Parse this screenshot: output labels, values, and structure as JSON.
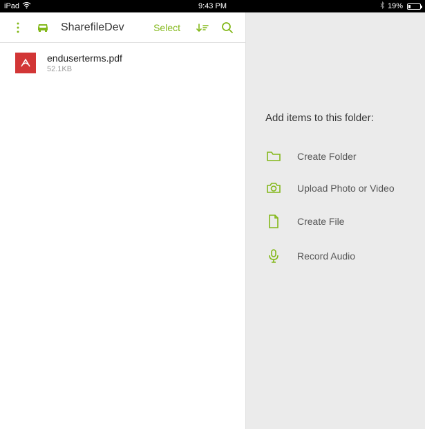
{
  "status_bar": {
    "device": "iPad",
    "time": "9:43 PM",
    "battery_percent": "19%"
  },
  "toolbar": {
    "title": "SharefileDev",
    "select_label": "Select"
  },
  "files": [
    {
      "name": "enduserterms.pdf",
      "size": "52.1KB"
    }
  ],
  "panel": {
    "title": "Add items to this folder:",
    "actions": [
      {
        "label": "Create Folder"
      },
      {
        "label": "Upload Photo or Video"
      },
      {
        "label": "Create File"
      },
      {
        "label": "Record Audio"
      }
    ]
  }
}
